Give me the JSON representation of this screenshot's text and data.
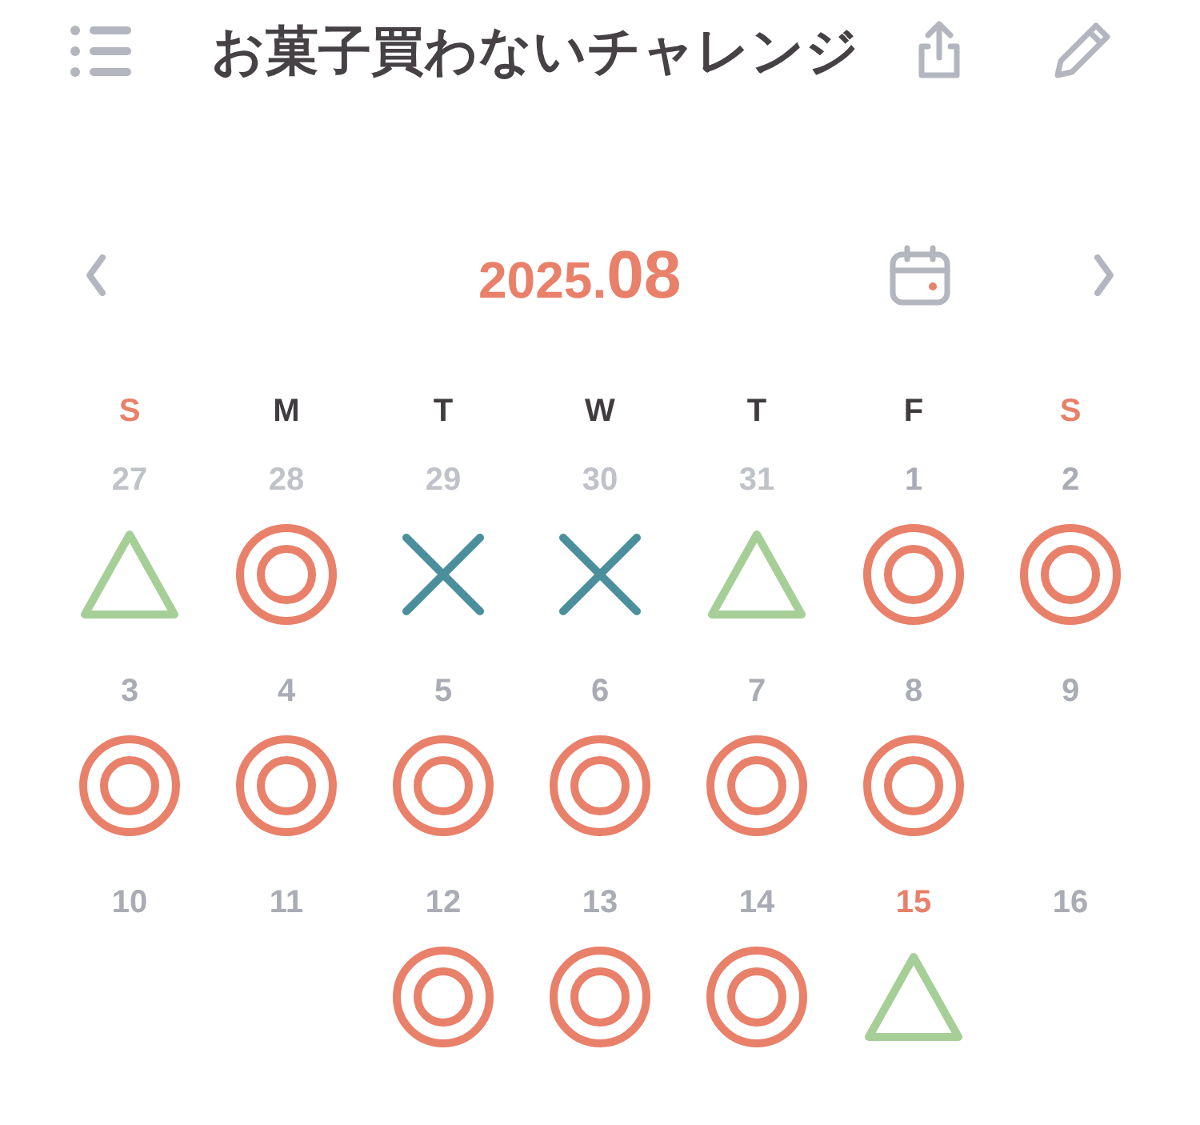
{
  "header": {
    "title": "お菓子買わないチャレンジ"
  },
  "month_nav": {
    "year": "2025.",
    "month": "08"
  },
  "weekdays": [
    {
      "label": "S",
      "weekend": true
    },
    {
      "label": "M",
      "weekend": false
    },
    {
      "label": "T",
      "weekend": false
    },
    {
      "label": "W",
      "weekend": false
    },
    {
      "label": "T",
      "weekend": false
    },
    {
      "label": "F",
      "weekend": false
    },
    {
      "label": "S",
      "weekend": true
    }
  ],
  "days": [
    {
      "date": "27",
      "outside": true,
      "today": false,
      "kind": "triangle"
    },
    {
      "date": "28",
      "outside": true,
      "today": false,
      "kind": "double-circle"
    },
    {
      "date": "29",
      "outside": true,
      "today": false,
      "kind": "cross"
    },
    {
      "date": "30",
      "outside": true,
      "today": false,
      "kind": "cross"
    },
    {
      "date": "31",
      "outside": true,
      "today": false,
      "kind": "triangle"
    },
    {
      "date": "1",
      "outside": false,
      "today": false,
      "kind": "double-circle"
    },
    {
      "date": "2",
      "outside": false,
      "today": false,
      "kind": "double-circle"
    },
    {
      "date": "3",
      "outside": false,
      "today": false,
      "kind": "double-circle"
    },
    {
      "date": "4",
      "outside": false,
      "today": false,
      "kind": "double-circle"
    },
    {
      "date": "5",
      "outside": false,
      "today": false,
      "kind": "double-circle"
    },
    {
      "date": "6",
      "outside": false,
      "today": false,
      "kind": "double-circle"
    },
    {
      "date": "7",
      "outside": false,
      "today": false,
      "kind": "double-circle"
    },
    {
      "date": "8",
      "outside": false,
      "today": false,
      "kind": "double-circle"
    },
    {
      "date": "9",
      "outside": false,
      "today": false,
      "kind": "none"
    },
    {
      "date": "10",
      "outside": false,
      "today": false,
      "kind": "none"
    },
    {
      "date": "11",
      "outside": false,
      "today": false,
      "kind": "none"
    },
    {
      "date": "12",
      "outside": false,
      "today": false,
      "kind": "double-circle"
    },
    {
      "date": "13",
      "outside": false,
      "today": false,
      "kind": "double-circle"
    },
    {
      "date": "14",
      "outside": false,
      "today": false,
      "kind": "double-circle"
    },
    {
      "date": "15",
      "outside": false,
      "today": true,
      "kind": "triangle"
    },
    {
      "date": "16",
      "outside": false,
      "today": false,
      "kind": "none"
    }
  ]
}
